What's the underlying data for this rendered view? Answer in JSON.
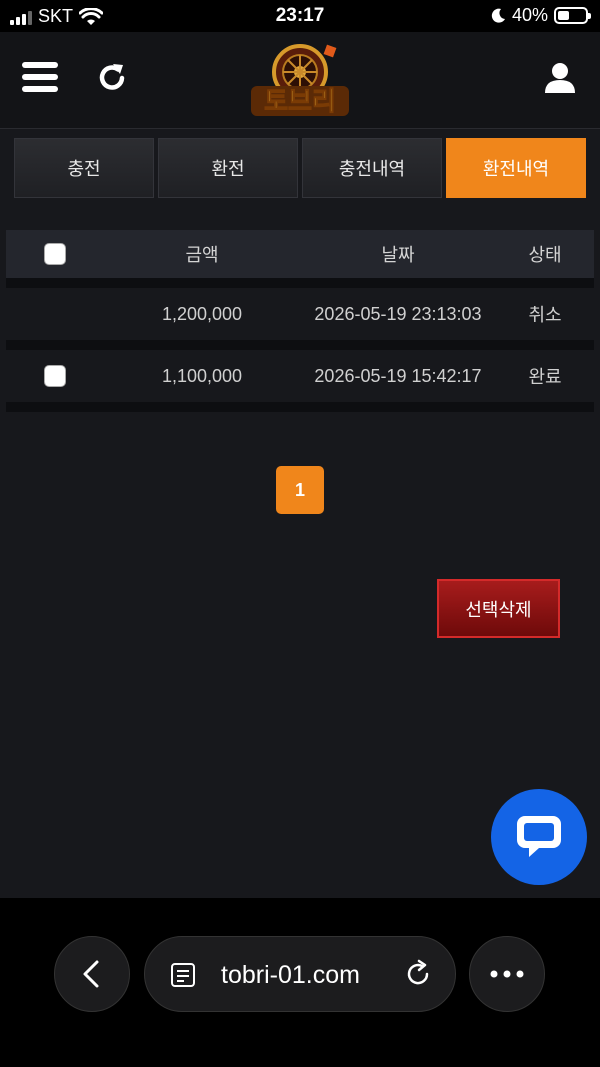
{
  "status_bar": {
    "carrier": "SKT",
    "time": "23:17",
    "battery_percent": "40%"
  },
  "tabs": [
    {
      "label": "충전",
      "active": false
    },
    {
      "label": "환전",
      "active": false
    },
    {
      "label": "충전내역",
      "active": false
    },
    {
      "label": "환전내역",
      "active": true
    }
  ],
  "table": {
    "headers": {
      "amount": "금액",
      "date": "날짜",
      "status": "상태"
    },
    "rows": [
      {
        "amount": "1,200,000",
        "date": "2026-05-19 23:13:03",
        "status": "취소",
        "checkbox": false
      },
      {
        "amount": "1,100,000",
        "date": "2026-05-19 15:42:17",
        "status": "완료",
        "checkbox": true
      }
    ]
  },
  "pagination": {
    "current_page": "1"
  },
  "delete_button": {
    "label": "선택삭제"
  },
  "browser": {
    "url": "tobri-01.com"
  },
  "colors": {
    "accent": "#f0861b",
    "danger": "#8b1010",
    "chat": "#1464e6",
    "background": "#17181c"
  },
  "icons": [
    "menu-icon",
    "refresh-icon",
    "logo-roulette",
    "user-icon",
    "chat-icon",
    "back-icon",
    "reader-icon",
    "reload-icon",
    "more-icon"
  ]
}
